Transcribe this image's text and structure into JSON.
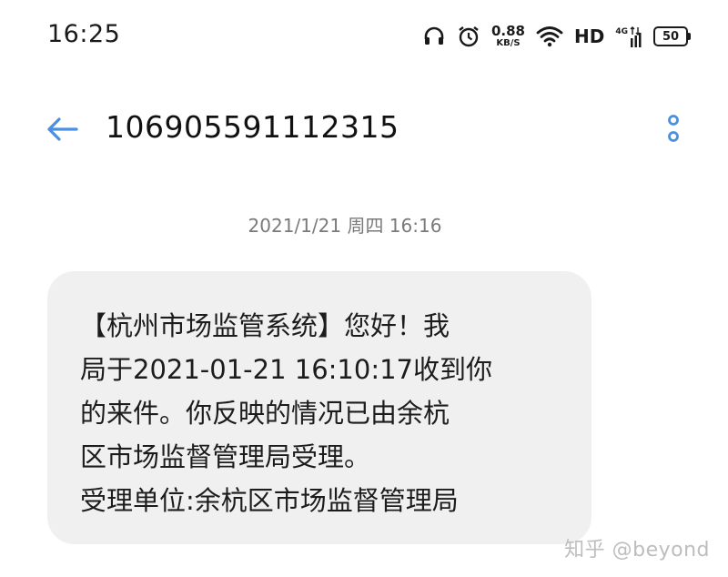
{
  "status_bar": {
    "time": "16:25",
    "icons": [
      "headphones-icon",
      "alarm-icon",
      "wifi-icon",
      "signal-icon",
      "battery-icon"
    ],
    "net_speed_value": "0.88",
    "net_speed_unit": "KB/S",
    "hd_label": "HD",
    "network_label": "4G",
    "battery_level": "50"
  },
  "header": {
    "back_icon": "arrow-left-icon",
    "sender_number": "106905591112315",
    "more_icon": "more-vertical-icon"
  },
  "conversation": {
    "timestamp": "2021/1/21 周四 16:16",
    "message_lines": [
      "【杭州市场监管系统】您好！我",
      "局于2021-01-21 16:10:17收到你",
      "的来件。你反映的情况已由余杭",
      "区市场监督管理局受理。",
      "受理单位:余杭区市场监督管理局"
    ]
  },
  "watermark": "知乎 @beyond",
  "colors": {
    "accent": "#4a8fe0",
    "bubble_bg": "#f0f0f0",
    "timestamp_text": "#7a7a7a",
    "watermark_text": "#bdbdbd"
  }
}
